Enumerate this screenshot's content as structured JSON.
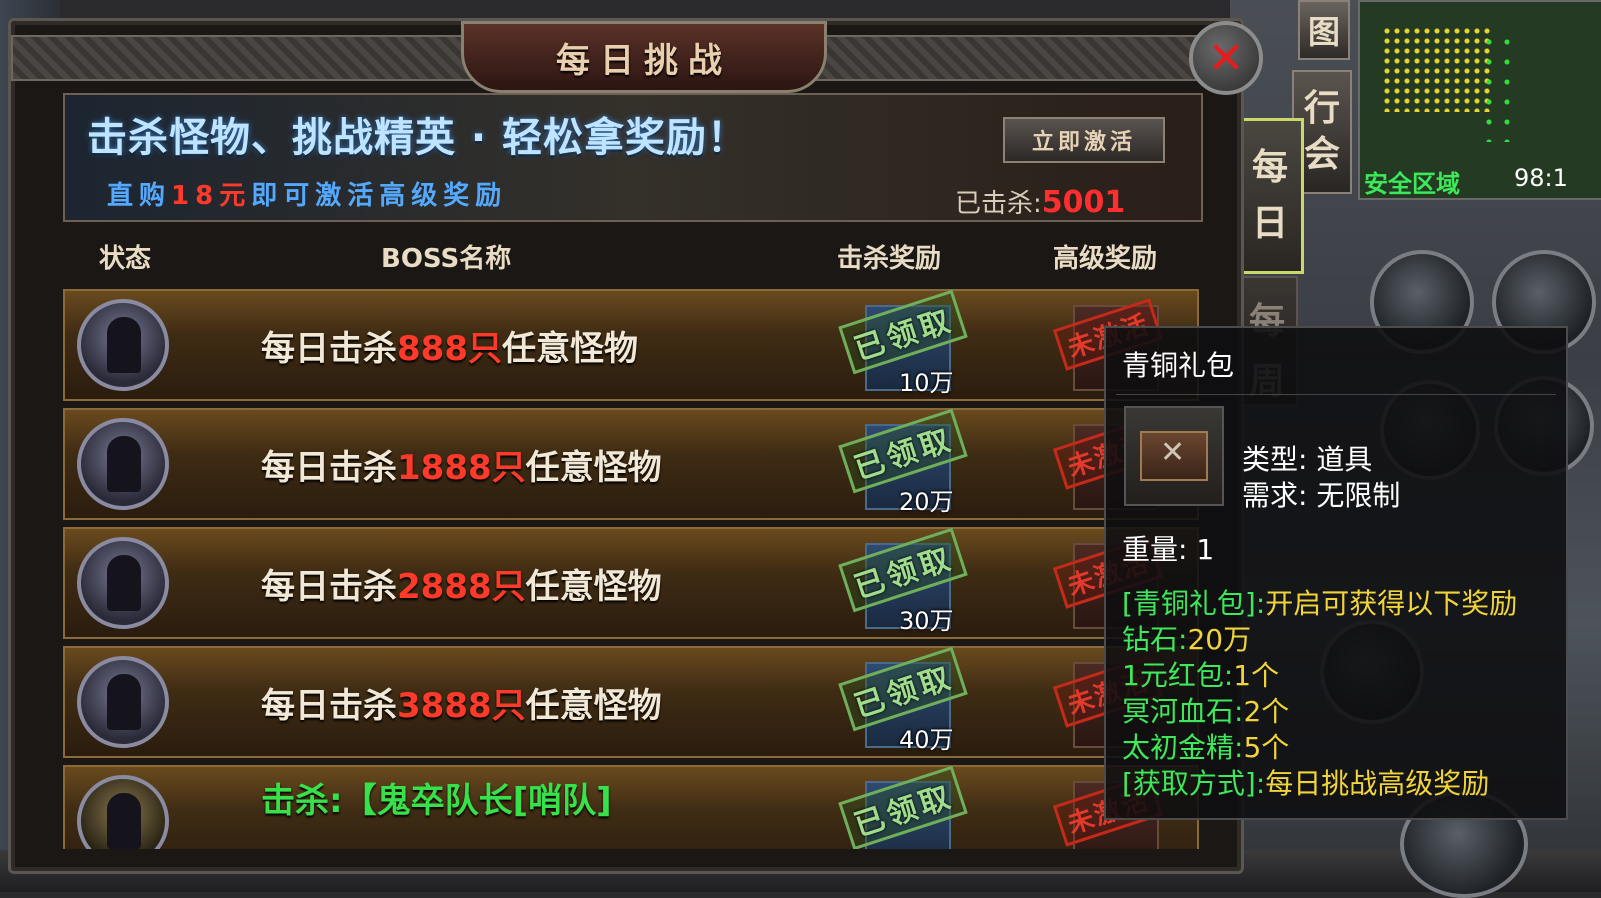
{
  "window": {
    "title": "每日挑战",
    "close_symbol": "✕"
  },
  "banner": {
    "headline": "击杀怪物、挑战精英 · 轻松拿奖励！",
    "sub_prefix": "直购",
    "sub_amount": "18元",
    "sub_suffix": "即可激活高级奖励",
    "activate_button": "立即激活",
    "kill_label": "已击杀:",
    "kill_count": "5001"
  },
  "table": {
    "headers": {
      "status": "状态",
      "boss_name": "BOSS名称",
      "kill_reward": "击杀奖励",
      "advanced_reward": "高级奖励"
    },
    "rows": [
      {
        "prefix": "每日击杀",
        "count": "888只",
        "suffix": "任意怪物",
        "reward_status": "已领取",
        "reward_amount": "10万",
        "advanced_status": "未激活"
      },
      {
        "prefix": "每日击杀",
        "count": "1888只",
        "suffix": "任意怪物",
        "reward_status": "已领取",
        "reward_amount": "20万",
        "advanced_status": "未激活"
      },
      {
        "prefix": "每日击杀",
        "count": "2888只",
        "suffix": "任意怪物",
        "reward_status": "已领取",
        "reward_amount": "30万",
        "advanced_status": "未激活"
      },
      {
        "prefix": "每日击杀",
        "count": "3888只",
        "suffix": "任意怪物",
        "reward_status": "已领取",
        "reward_amount": "40万",
        "advanced_status": "未激活"
      },
      {
        "boss_kill_label": "击杀:【鬼卒队长[哨队]",
        "reward_status": "已领取",
        "advanced_status": "未激活"
      }
    ]
  },
  "side_tabs": {
    "daily": [
      "每",
      "日"
    ],
    "weekly": [
      "每",
      "周"
    ]
  },
  "hud": {
    "map_button": "图",
    "guild_button": [
      "行",
      "会"
    ],
    "safe_zone": "安全区域",
    "coord": "98:1"
  },
  "tooltip": {
    "title": "青铜礼包",
    "type_label": "类型:",
    "type_value": "道具",
    "req_label": "需求:",
    "req_value": "无限制",
    "weight_label": "重量:",
    "weight_value": "1",
    "lines": [
      {
        "label": "[青铜礼包]:",
        "value": "开启可获得以下奖励"
      },
      {
        "label": "钻石:",
        "value": "20万"
      },
      {
        "label": "1元红包:",
        "value": "1个"
      },
      {
        "label": "冥河血石:",
        "value": "2个"
      },
      {
        "label": "太初金精:",
        "value": "5个"
      },
      {
        "label": "[获取方式]:",
        "value": "每日挑战高级奖励"
      }
    ]
  },
  "colors": {
    "accent_red": "#ff3a2a",
    "headline_blue": "#bfe4ff",
    "tooltip_green": "#3de85a",
    "tooltip_yellow": "#f0d43a"
  }
}
